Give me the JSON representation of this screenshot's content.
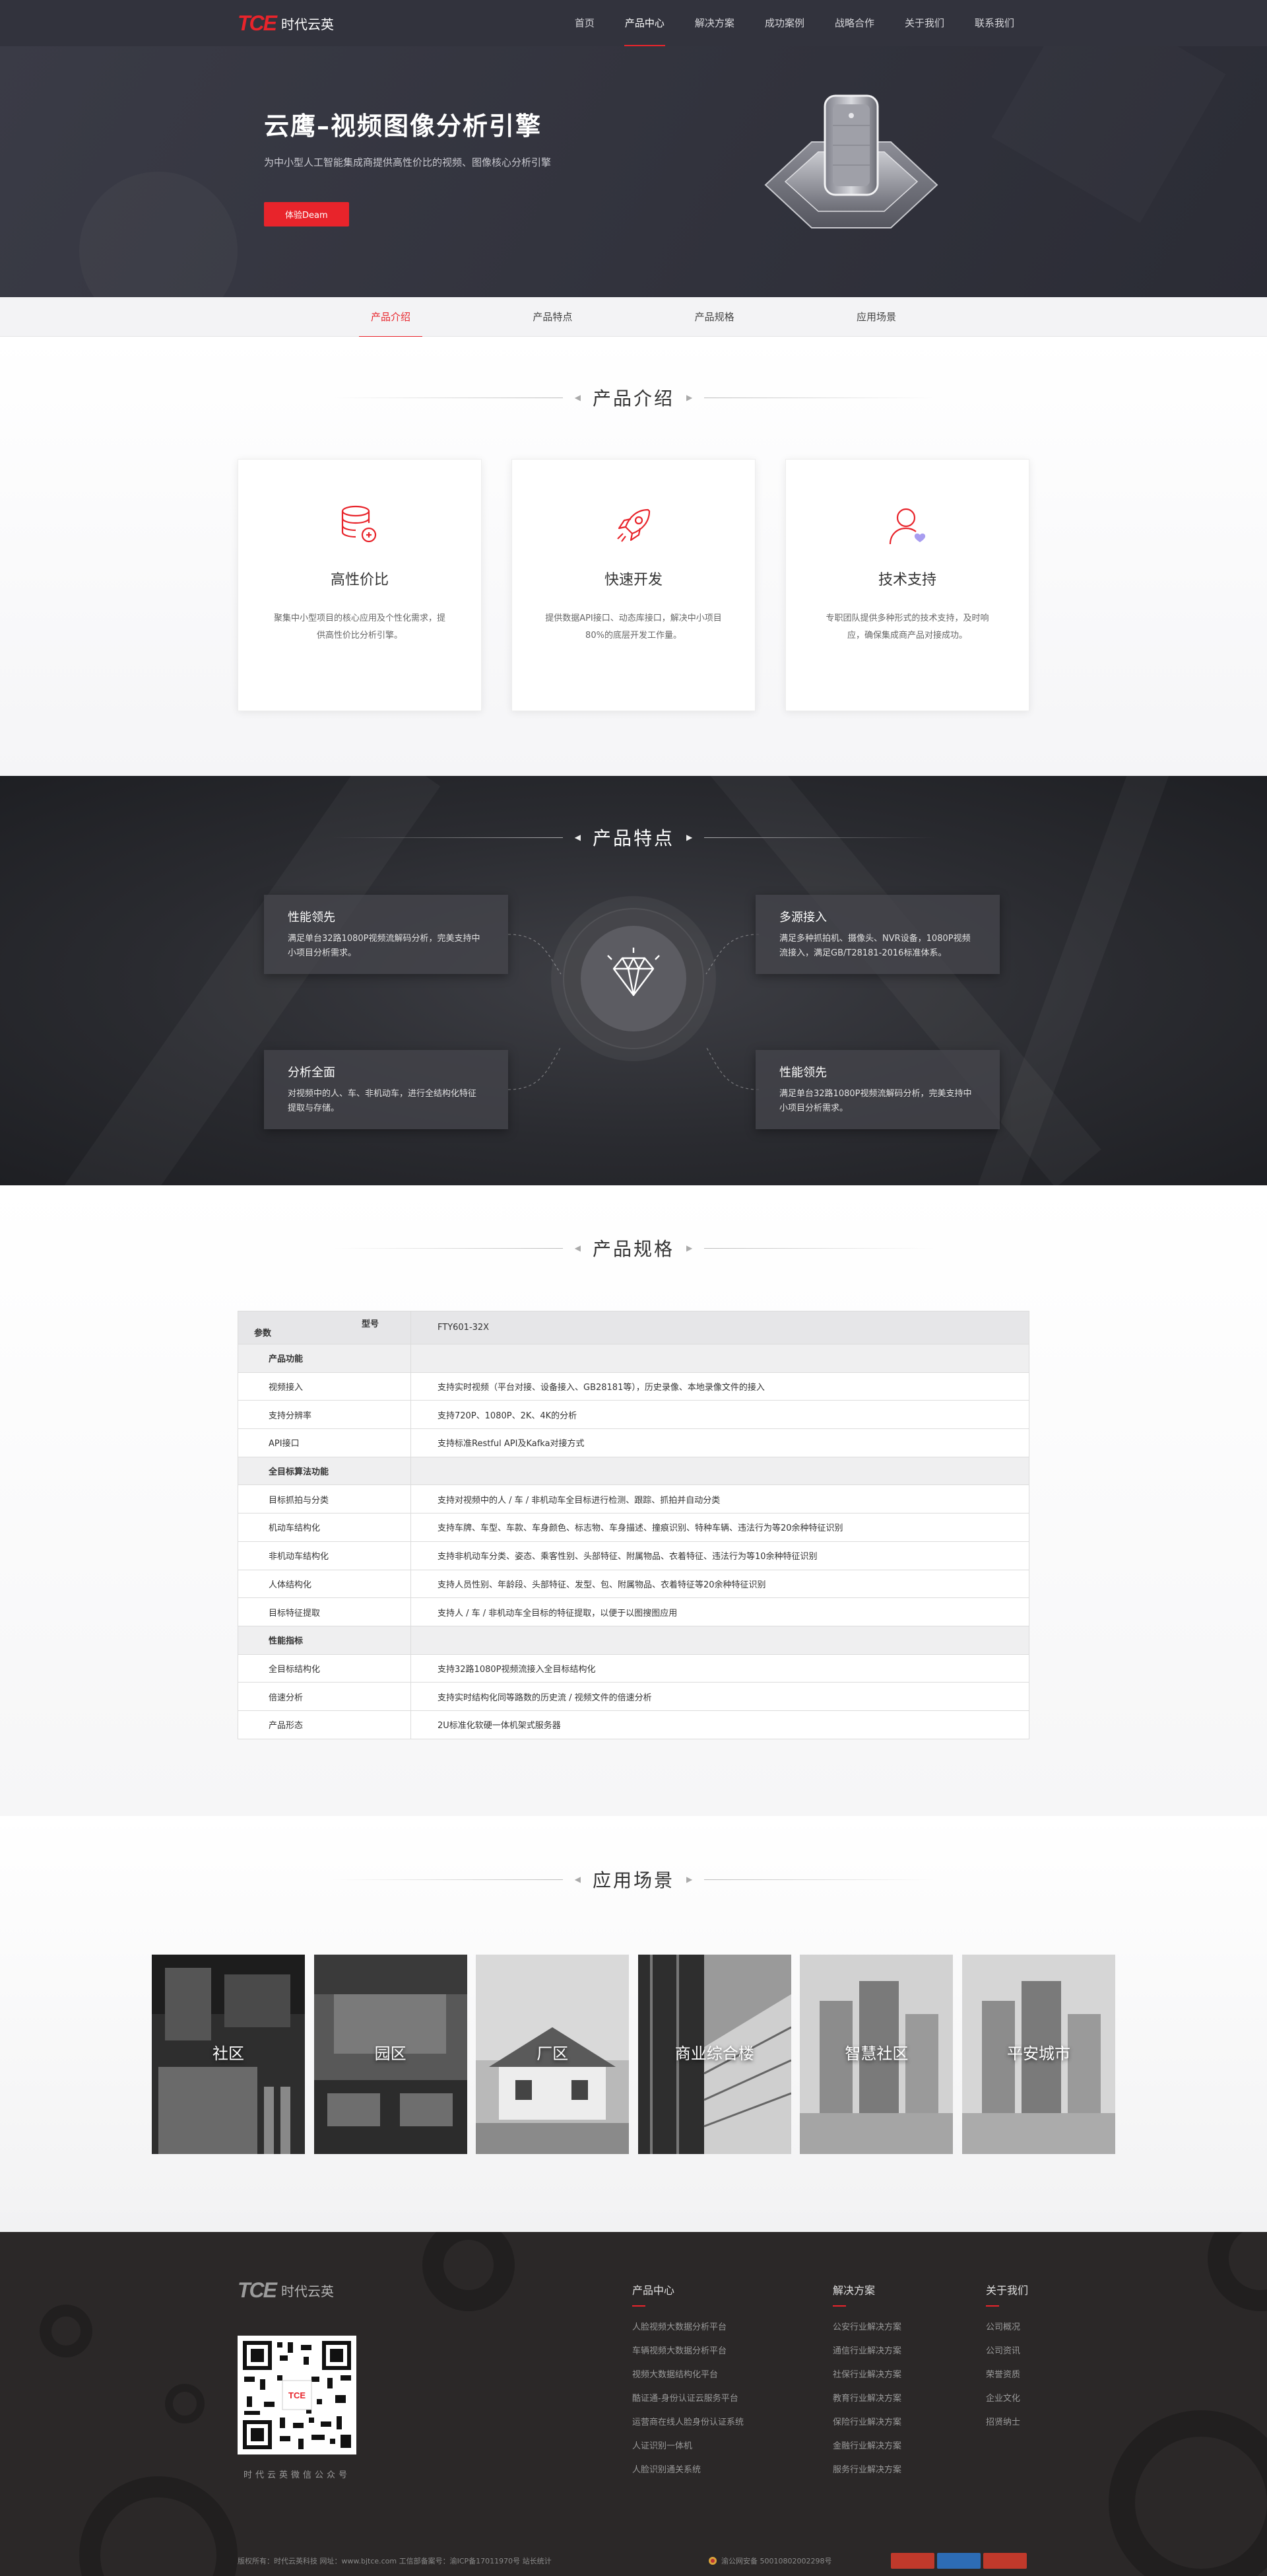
{
  "header": {
    "logo_mark": "TCE",
    "logo_text": "时代云英",
    "nav": [
      "首页",
      "产品中心",
      "解决方案",
      "成功案例",
      "战略合作",
      "关于我们",
      "联系我们"
    ],
    "active_nav": "产品中心"
  },
  "hero": {
    "title": "云鹰–视频图像分析引擎",
    "subtitle": "为中小型人工智能集成商提供高性价比的视频、图像核心分析引擎",
    "button": "体验Deam"
  },
  "subtabs": [
    "产品介绍",
    "产品特点",
    "产品规格",
    "应用场景"
  ],
  "intro": {
    "heading": "产品介绍",
    "cards": [
      {
        "icon": "database-icon",
        "title": "高性价比",
        "text": "聚集中小型项目的核心应用及个性化需求，提供高性价比分析引擎。"
      },
      {
        "icon": "rocket-icon",
        "title": "快速开发",
        "text": "提供数据API接口、动态库接口，解决中小项目80%的底层开发工作量。"
      },
      {
        "icon": "user-support-icon",
        "title": "技术支持",
        "text": "专职团队提供多种形式的技术支持，及时响应，确保集成商产品对接成功。"
      }
    ]
  },
  "features": {
    "heading": "产品特点",
    "items": [
      {
        "title": "性能领先",
        "text": "满足单台32路1080P视频流解码分析，完美支持中小项目分析需求。"
      },
      {
        "title": "多源接入",
        "text": "满足多种抓拍机、摄像头、NVR设备，1080P视频流接入，满足GB/T28181-2016标准体系。"
      },
      {
        "title": "分析全面",
        "text": "对视频中的人、车、非机动车，进行全结构化特征提取与存储。"
      },
      {
        "title": "性能领先",
        "text": "满足单台32路1080P视频流解码分析，完美支持中小项目分析需求。"
      }
    ]
  },
  "spec": {
    "heading": "产品规格",
    "header_top": "型号",
    "header_bottom": "参数",
    "model": "FTY601-32X",
    "rows": [
      {
        "group": true,
        "name": "产品功能",
        "value": ""
      },
      {
        "group": false,
        "name": "视频接入",
        "value": "支持实时视频（平台对接、设备接入、GB28181等），历史录像、本地录像文件的接入"
      },
      {
        "group": false,
        "name": "支持分辨率",
        "value": "支持720P、1080P、2K、4K的分析"
      },
      {
        "group": false,
        "name": "API接口",
        "value": "支持标准Restful API及Kafka对接方式"
      },
      {
        "group": true,
        "name": "全目标算法功能",
        "value": ""
      },
      {
        "group": false,
        "name": "目标抓拍与分类",
        "value": "支持对视频中的人 / 车 / 非机动车全目标进行检测、跟踪、抓拍并自动分类"
      },
      {
        "group": false,
        "name": "机动车结构化",
        "value": "支持车牌、车型、车款、车身颜色、标志物、车身描述、撞痕识别、特种车辆、违法行为等20余种特征识别"
      },
      {
        "group": false,
        "name": "非机动车结构化",
        "value": "支持非机动车分类、姿态、乘客性别、头部特征、附属物品、衣着特征、违法行为等10余种特征识别"
      },
      {
        "group": false,
        "name": "人体结构化",
        "value": "支持人员性别、年龄段、头部特征、发型、包、附属物品、衣着特征等20余种特征识别"
      },
      {
        "group": false,
        "name": "目标特征提取",
        "value": "支持人 / 车 / 非机动车全目标的特征提取，以便于以图搜图应用"
      },
      {
        "group": true,
        "name": "性能指标",
        "value": ""
      },
      {
        "group": false,
        "name": "全目标结构化",
        "value": "支持32路1080P视频流接入全目标结构化"
      },
      {
        "group": false,
        "name": "倍速分析",
        "value": "支持实时结构化同等路数的历史流 / 视频文件的倍速分析"
      },
      {
        "group": false,
        "name": "产品形态",
        "value": "2U标准化软硬一体机架式服务器"
      }
    ]
  },
  "scenes": {
    "heading": "应用场景",
    "items": [
      "社区",
      "园区",
      "厂区",
      "商业综合楼",
      "智慧社区",
      "平安城市"
    ]
  },
  "footer": {
    "logo_mark": "TCE",
    "logo_text": "时代云英",
    "qr_caption": "时代云英微信公众号",
    "columns": [
      {
        "title": "产品中心",
        "links": [
          "人脸视频大数据分析平台",
          "车辆视频大数据分析平台",
          "视频大数据结构化平台",
          "酷证通-身份认证云服务平台",
          "运营商在线人脸身份认证系统",
          "人证识别一体机",
          "人脸识别通关系统"
        ]
      },
      {
        "title": "解决方案",
        "links": [
          "公安行业解决方案",
          "通信行业解决方案",
          "社保行业解决方案",
          "教育行业解决方案",
          "保险行业解决方案",
          "金融行业解决方案",
          "服务行业解决方案"
        ]
      },
      {
        "title": "关于我们",
        "links": [
          "公司概况",
          "公司资讯",
          "荣誉资质",
          "企业文化",
          "招贤纳士"
        ]
      }
    ],
    "copyright": "版权所有：时代云英科技    网址：www.bjtce.com    工信部备案号：渝ICP备17011970号 站长统计",
    "police": "渝公网安备 50010802002298号"
  },
  "colors": {
    "accent": "#e8242b",
    "header_bg": "#32333d",
    "footer_bg": "#2b2828"
  }
}
